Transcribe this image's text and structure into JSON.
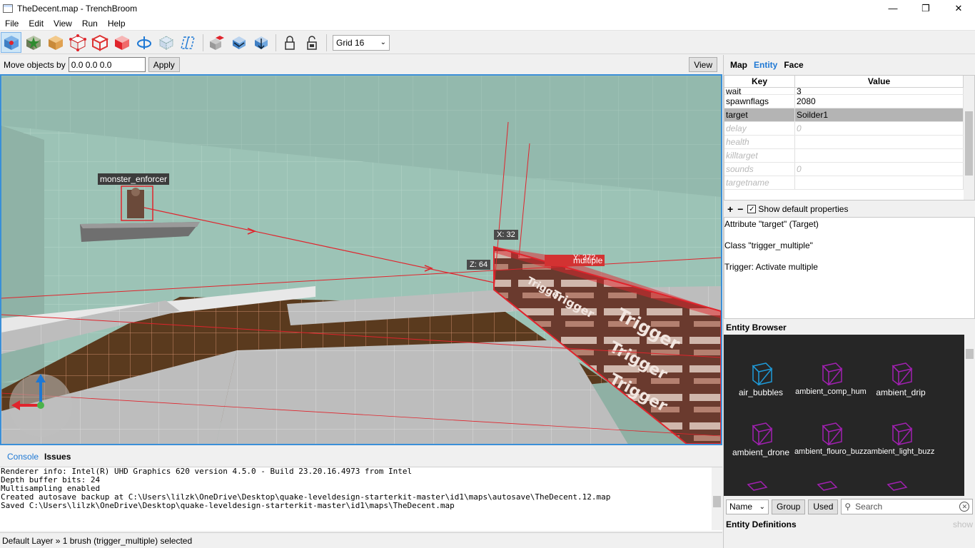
{
  "window": {
    "title": "TheDecent.map - TrenchBroom"
  },
  "menu": [
    "File",
    "Edit",
    "View",
    "Run",
    "Help"
  ],
  "toolbar": {
    "tools": [
      "select-tool",
      "entity-tool",
      "brush-tool",
      "vertex-tool",
      "edge-tool",
      "face-tool",
      "rotate-tool",
      "clip-tool",
      "shear-tool"
    ],
    "grid_label": "Grid 16"
  },
  "move_bar": {
    "label": "Move objects by",
    "value": "0.0 0.0 0.0",
    "apply": "Apply",
    "view": "View"
  },
  "viewport": {
    "entity_label": "monster_enforcer",
    "trigger_label": "multiple",
    "dim_x": "X: 32",
    "dim_y": "Y: 272",
    "dim_z": "Z: 64"
  },
  "console": {
    "tabs": [
      "Console",
      "Issues"
    ],
    "lines": [
      "Renderer info: Intel(R) UHD Graphics 620 version 4.5.0 - Build 23.20.16.4973 from Intel",
      "Depth buffer bits: 24",
      "Multisampling enabled",
      "Created autosave backup at C:\\Users\\lilzk\\OneDrive\\Desktop\\quake-leveldesign-starterkit-master\\id1\\maps\\autosave\\TheDecent.12.map",
      "Saved C:\\Users\\lilzk\\OneDrive\\Desktop\\quake-leveldesign-starterkit-master\\id1\\maps\\TheDecent.map"
    ]
  },
  "status": "Default Layer » 1 brush (trigger_multiple) selected",
  "inspector": {
    "tabs": [
      "Map",
      "Entity",
      "Face"
    ],
    "columns": {
      "key": "Key",
      "value": "Value"
    },
    "rows": [
      {
        "key": "wait",
        "value": "3"
      },
      {
        "key": "spawnflags",
        "value": "2080"
      },
      {
        "key": "target",
        "value": "Soilder1"
      },
      {
        "key": "delay",
        "value": "0"
      },
      {
        "key": "health",
        "value": ""
      },
      {
        "key": "killtarget",
        "value": ""
      },
      {
        "key": "sounds",
        "value": "0"
      },
      {
        "key": "targetname",
        "value": ""
      }
    ],
    "add": "+",
    "remove": "−",
    "show_default": "Show default properties",
    "doc": {
      "attribute": "Attribute \"target\" (Target)",
      "class": "Class \"trigger_multiple\"",
      "desc": "Trigger: Activate multiple"
    }
  },
  "entity_browser": {
    "title": "Entity Browser",
    "items": [
      "air_bubbles",
      "ambient_comp_hum",
      "ambient_drip",
      "ambient_drone",
      "ambient_flouro_buzz",
      "ambient_light_buzz"
    ],
    "sort": "Name",
    "group": "Group",
    "used": "Used",
    "search_placeholder": "Search"
  },
  "entity_definitions": {
    "title": "Entity Definitions",
    "show": "show"
  },
  "colors": {
    "accent": "#1e78d4",
    "selection": "#e0242c",
    "trigger": "#5a2e24"
  }
}
